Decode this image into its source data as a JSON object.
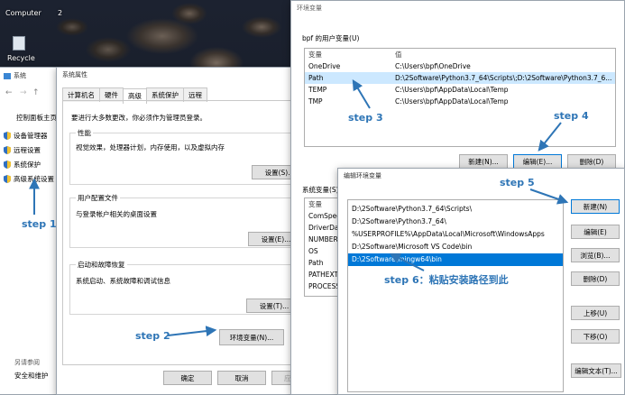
{
  "desktop": {
    "computer_label": "Computer",
    "recycle_label": "Recycle",
    "bin_count": "2"
  },
  "left_panel": {
    "title": "系统",
    "home_link": "控制面板主页",
    "items": [
      "设备管理器",
      "远程设置",
      "系统保护",
      "高级系统设置"
    ],
    "see_also": "另请参阅",
    "security": "安全和维护"
  },
  "sys_props": {
    "title": "系统属性",
    "tabs": [
      "计算机名",
      "硬件",
      "高级",
      "系统保护",
      "远程"
    ],
    "admin_note": "要进行大多数更改，你必须作为管理员登录。",
    "perf_title": "性能",
    "perf_desc": "视觉效果，处理器计划，内存使用，以及虚拟内存",
    "profile_title": "用户配置文件",
    "profile_desc": "与登录帐户相关的桌面设置",
    "startup_title": "启动和故障恢复",
    "startup_desc": "系统启动、系统故障和调试信息",
    "settings_btn": "设置(S)...",
    "settings_e_btn": "设置(E)...",
    "settings_t_btn": "设置(T)...",
    "env_btn": "环境变量(N)...",
    "ok": "确定",
    "cancel": "取消",
    "apply": "应用(A)"
  },
  "env_vars": {
    "title": "环境变量",
    "user_group": "bpf 的用户变量(U)",
    "col_var": "变量",
    "col_val": "值",
    "user_rows": [
      {
        "name": "OneDrive",
        "value": "C:\\Users\\bpf\\OneDrive"
      },
      {
        "name": "Path",
        "value": "D:\\2Software\\Python3.7_64\\Scripts\\;D:\\2Software\\Python3.7_6..."
      },
      {
        "name": "TEMP",
        "value": "C:\\Users\\bpf\\AppData\\Local\\Temp"
      },
      {
        "name": "TMP",
        "value": "C:\\Users\\bpf\\AppData\\Local\\Temp"
      }
    ],
    "new_btn": "新建(N)...",
    "edit_btn": "编辑(E)...",
    "delete_btn": "删除(D)",
    "sys_group": "系统变量(S)",
    "sys_rows": [
      "变量",
      "ComSpec",
      "DriverData",
      "NUMBER_",
      "OS",
      "Path",
      "PATHEXT",
      "PROCESSO"
    ]
  },
  "edit_env": {
    "title": "编辑环境变量",
    "paths": [
      "D:\\2Software\\Python3.7_64\\Scripts\\",
      "D:\\2Software\\Python3.7_64\\",
      "%USERPROFILE%\\AppData\\Local\\Microsoft\\WindowsApps",
      "D:\\2Software\\Microsoft VS Code\\bin",
      "D:\\2Software\\mingw64\\bin"
    ],
    "new_btn": "新建(N)",
    "edit_btn": "编辑(E)",
    "browse_btn": "浏览(B)...",
    "delete_btn": "删除(D)",
    "up_btn": "上移(U)",
    "down_btn": "下移(O)",
    "edit_text_btn": "编辑文本(T)..."
  },
  "annotations": {
    "step1": "step 1",
    "step2": "step 2",
    "step3": "step 3",
    "step4": "step 4",
    "step5": "step 5",
    "step6": "step 6：粘贴安装路径到此",
    "color": "#2e75b6"
  }
}
